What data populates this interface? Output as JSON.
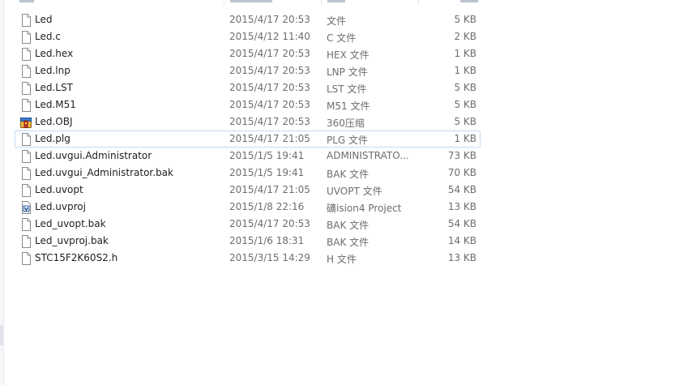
{
  "files": [
    {
      "name": "Led",
      "date": "2015/4/17 20:53",
      "type": "文件",
      "size": "5 KB",
      "icon": "generic-file-icon"
    },
    {
      "name": "Led.c",
      "date": "2015/4/12 11:40",
      "type": "C 文件",
      "size": "2 KB",
      "icon": "generic-file-icon"
    },
    {
      "name": "Led.hex",
      "date": "2015/4/17 20:53",
      "type": "HEX 文件",
      "size": "1 KB",
      "icon": "generic-file-icon"
    },
    {
      "name": "Led.lnp",
      "date": "2015/4/17 20:53",
      "type": "LNP 文件",
      "size": "1 KB",
      "icon": "generic-file-icon"
    },
    {
      "name": "Led.LST",
      "date": "2015/4/17 20:53",
      "type": "LST 文件",
      "size": "5 KB",
      "icon": "generic-file-icon"
    },
    {
      "name": "Led.M51",
      "date": "2015/4/17 20:53",
      "type": "M51 文件",
      "size": "5 KB",
      "icon": "generic-file-icon"
    },
    {
      "name": "Led.OBJ",
      "date": "2015/4/17 20:53",
      "type": "360压缩",
      "size": "5 KB",
      "icon": "archive-icon"
    },
    {
      "name": "Led.plg",
      "date": "2015/4/17 21:05",
      "type": "PLG 文件",
      "size": "1 KB",
      "icon": "generic-file-icon",
      "selected": true
    },
    {
      "name": "Led.uvgui.Administrator",
      "date": "2015/1/5 19:41",
      "type": "ADMINISTRATO...",
      "size": "73 KB",
      "icon": "generic-file-icon"
    },
    {
      "name": "Led.uvgui_Administrator.bak",
      "date": "2015/1/5 19:41",
      "type": "BAK 文件",
      "size": "70 KB",
      "icon": "generic-file-icon"
    },
    {
      "name": "Led.uvopt",
      "date": "2015/4/17 21:05",
      "type": "UVOPT 文件",
      "size": "54 KB",
      "icon": "generic-file-icon"
    },
    {
      "name": "Led.uvproj",
      "date": "2015/1/8 22:16",
      "type": "礦ision4 Project",
      "size": "13 KB",
      "icon": "uvision-project-icon"
    },
    {
      "name": "Led_uvopt.bak",
      "date": "2015/4/17 20:53",
      "type": "BAK 文件",
      "size": "54 KB",
      "icon": "generic-file-icon"
    },
    {
      "name": "Led_uvproj.bak",
      "date": "2015/1/6 18:31",
      "type": "BAK 文件",
      "size": "14 KB",
      "icon": "generic-file-icon"
    },
    {
      "name": "STC15F2K60S2.h",
      "date": "2015/3/15 14:29",
      "type": "H 文件",
      "size": "13 KB",
      "icon": "generic-file-icon"
    }
  ],
  "colors": {
    "selection_border": "#c3dbf3",
    "secondary_text": "#6d6d6d",
    "primary_text": "#1e1e1e"
  }
}
